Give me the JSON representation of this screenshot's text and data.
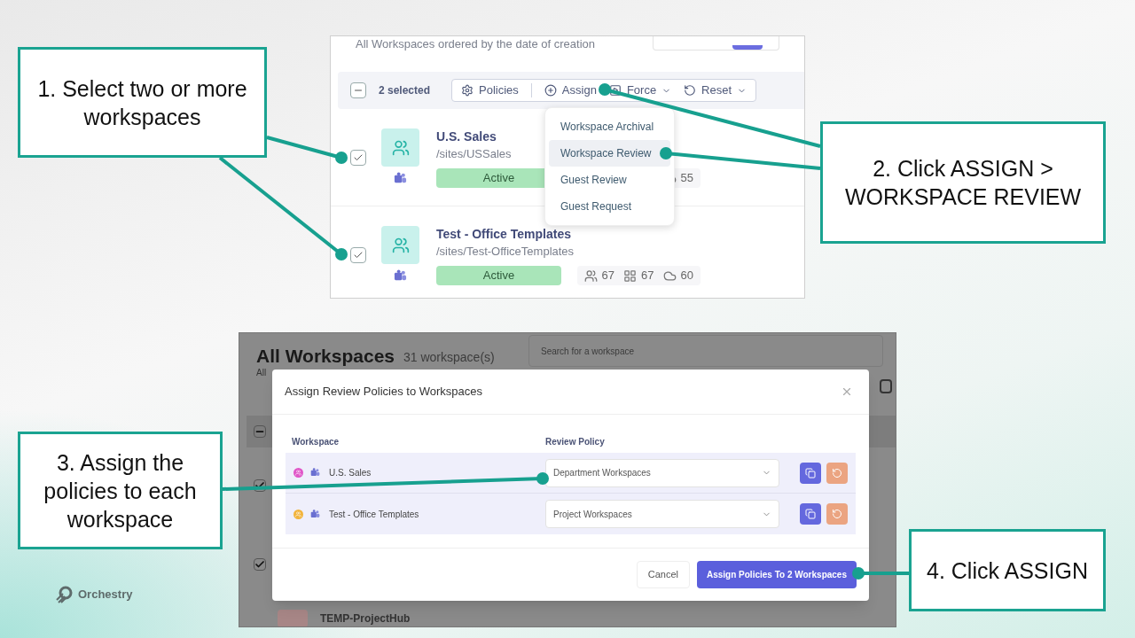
{
  "callouts": [
    {
      "text": "1. Select two or more workspaces"
    },
    {
      "text": "2. Click ASSIGN > WORKSPACE REVIEW"
    },
    {
      "text": "3. Assign the policies to each workspace"
    },
    {
      "text": "4. Click ASSIGN"
    }
  ],
  "top_screenshot": {
    "subtitle": "All Workspaces ordered by the date of creation",
    "selection": {
      "count_label": "2 selected",
      "partial": true
    },
    "actions": [
      {
        "label": "Policies",
        "kind": "policies",
        "has_menu": false
      },
      {
        "label": "Assign",
        "kind": "assign",
        "has_menu": false
      },
      {
        "label": "Force",
        "kind": "force",
        "has_menu": true
      },
      {
        "label": "Reset",
        "kind": "reset",
        "has_menu": true
      }
    ],
    "menu": [
      {
        "label": "Workspace Archival",
        "selected": false
      },
      {
        "label": "Workspace Review",
        "selected": true
      },
      {
        "label": "Guest Review",
        "selected": false
      },
      {
        "label": "Guest Request",
        "selected": false
      }
    ],
    "rows": [
      {
        "name": "U.S. Sales",
        "path": "/sites/USSales",
        "status": "Active",
        "checked": true,
        "stats": [
          {
            "kind": "cloud",
            "value": "55"
          }
        ]
      },
      {
        "name": "Test - Office Templates",
        "path": "/sites/Test-OfficeTemplates",
        "status": "Active",
        "checked": true,
        "stats": [
          {
            "kind": "teams",
            "value": "67"
          },
          {
            "kind": "files",
            "value": "67"
          },
          {
            "kind": "cloud",
            "value": "60"
          }
        ]
      }
    ]
  },
  "bottom_screenshot": {
    "page_title": "All Workspaces",
    "count": "31 workspace(s)",
    "subtitle": "All",
    "search": {
      "placeholder": "Search for a workspace"
    },
    "select_all_partial": true,
    "background_checkboxes": [
      {
        "checked": true
      },
      {
        "checked": true
      }
    ],
    "last_row": "TEMP-ProjectHub",
    "dialog": {
      "title": "Assign Review Policies to Workspaces",
      "columns": [
        "Workspace",
        "Review Policy"
      ],
      "rows": [
        {
          "name": "U.S. Sales",
          "color": "#e056c8",
          "policy": "Department Workspaces"
        },
        {
          "name": "Test - Office Templates",
          "color": "#f2b43c",
          "policy": "Project Workspaces"
        }
      ],
      "cancel": "Cancel",
      "confirm": "Assign Policies To 2 Workspaces"
    }
  },
  "brand": "Orchestry"
}
